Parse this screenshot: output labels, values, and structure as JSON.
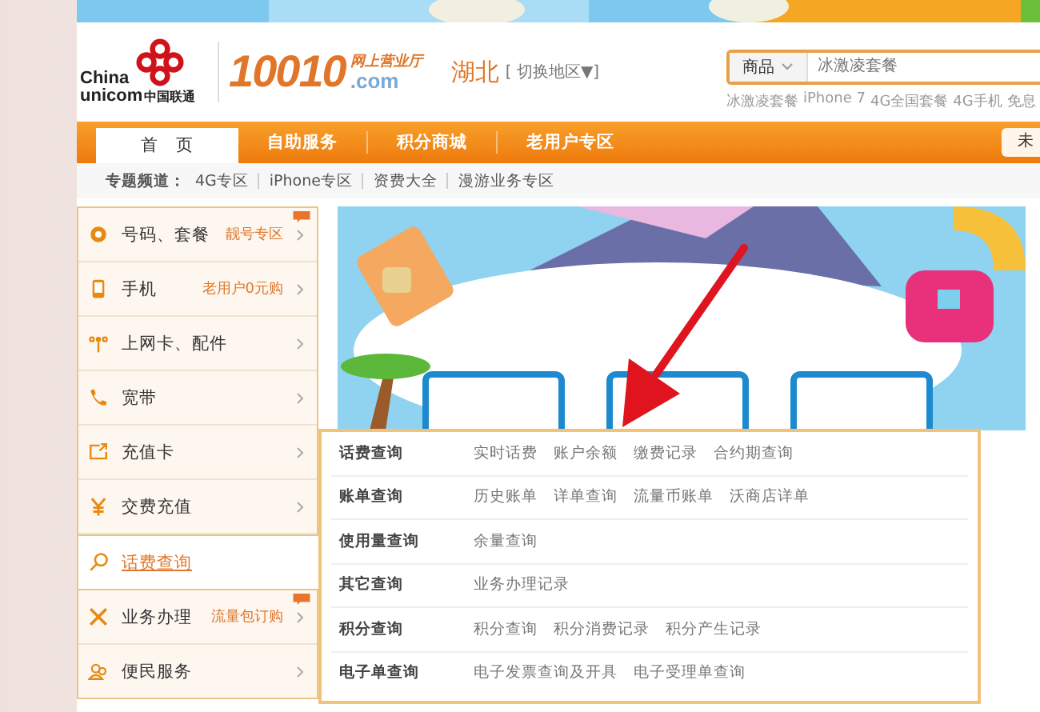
{
  "header": {
    "logo_en": [
      "China",
      "unicom"
    ],
    "logo_cn": "中国联通",
    "site_number": "10010",
    "site_tagline": "网上营业厅",
    "site_domain": ".com",
    "region": "湖北",
    "region_switch": "[ 切换地区▼]",
    "search": {
      "category": "商品",
      "placeholder": "冰激凌套餐"
    },
    "hot_words": [
      "冰激凌套餐",
      "iPhone 7",
      "4G全国套餐",
      "4G手机",
      "免息"
    ]
  },
  "nav": {
    "tabs": [
      {
        "label": "首　页",
        "selected": true
      },
      {
        "label": "自助服务",
        "selected": false
      },
      {
        "label": "积分商城",
        "selected": false
      },
      {
        "label": "老用户专区",
        "selected": false
      }
    ],
    "right_button": "未"
  },
  "sub_nav": {
    "label": "专题频道：",
    "links": [
      "4G专区",
      "iPhone专区",
      "资费大全",
      "漫游业务专区"
    ]
  },
  "side_menu": [
    {
      "label": "号码、套餐",
      "promo": "靓号专区",
      "hot": true,
      "selected": false
    },
    {
      "label": "手机",
      "promo": "老用户0元购",
      "hot": false,
      "selected": false
    },
    {
      "label": "上网卡、配件",
      "hot": false,
      "selected": false
    },
    {
      "label": "宽带",
      "hot": false,
      "selected": false
    },
    {
      "label": "充值卡",
      "hot": false,
      "selected": false
    },
    {
      "label": "交费充值",
      "hot": false,
      "selected": false
    },
    {
      "label": "话费查询",
      "hot": false,
      "selected": true
    },
    {
      "label": "业务办理",
      "promo": "流量包订购",
      "hot": true,
      "selected": false
    },
    {
      "label": "便民服务",
      "hot": false,
      "selected": false
    }
  ],
  "dropdown": [
    {
      "category": "话费查询",
      "links": [
        "实时话费",
        "账户余额",
        "缴费记录",
        "合约期查询"
      ]
    },
    {
      "category": "账单查询",
      "links": [
        "历史账单",
        "详单查询",
        "流量币账单",
        "沃商店详单"
      ]
    },
    {
      "category": "使用量查询",
      "links": [
        "余量查询"
      ]
    },
    {
      "category": "其它查询",
      "links": [
        "业务办理记录"
      ]
    },
    {
      "category": "积分查询",
      "links": [
        "积分查询",
        "积分消费记录",
        "积分产生记录"
      ]
    },
    {
      "category": "电子单查询",
      "links": [
        "电子发票查询及开具",
        "电子受理单查询"
      ]
    }
  ],
  "annotation_arrow": true
}
